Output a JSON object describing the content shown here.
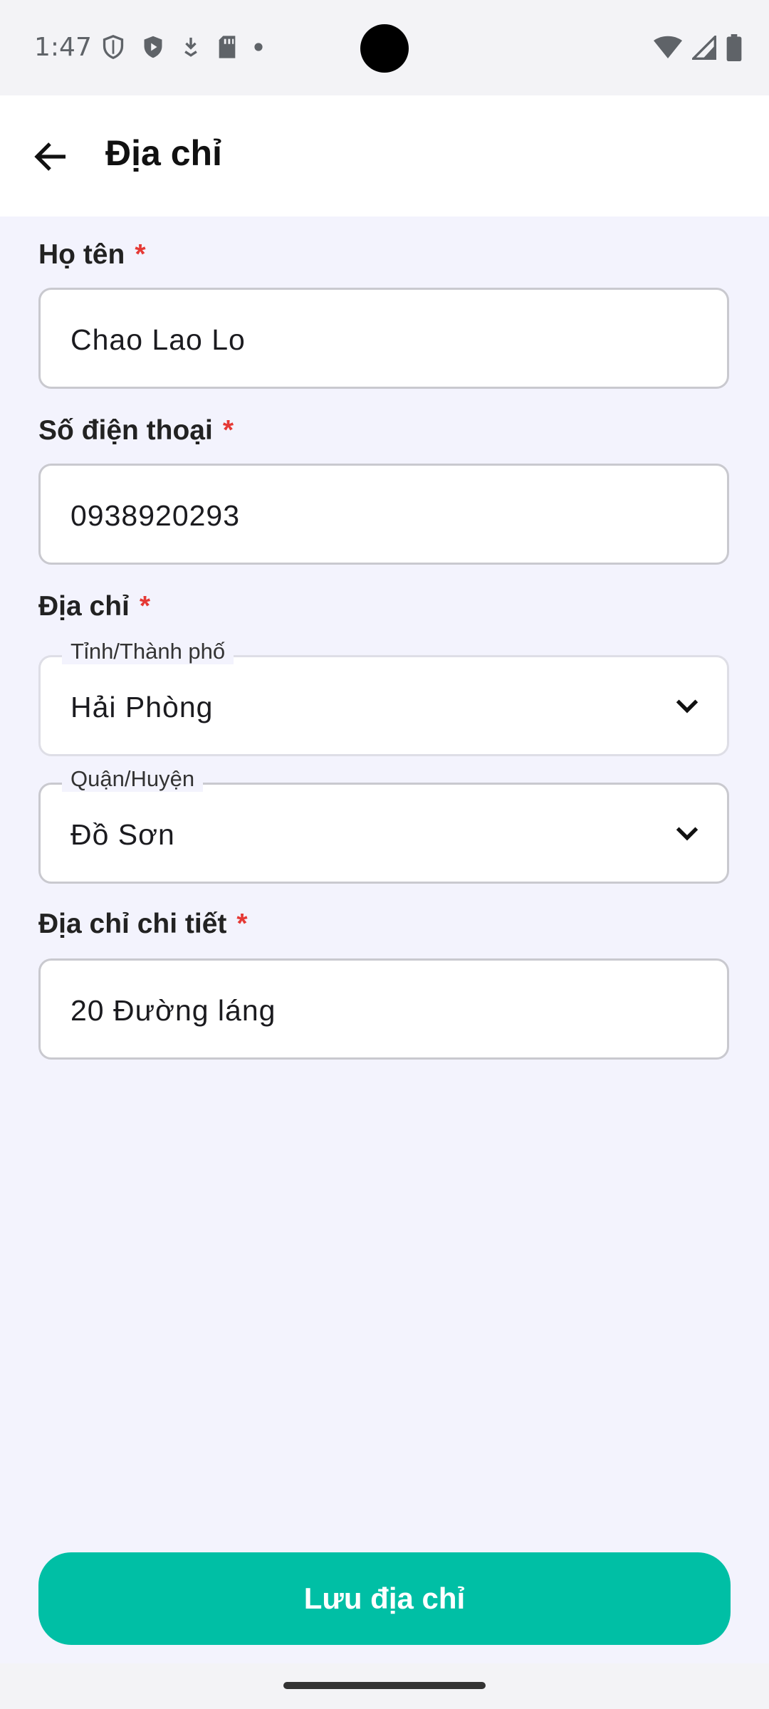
{
  "status_bar": {
    "time": "1:47",
    "icons_left": [
      "shield-outline-icon",
      "shield-play-icon",
      "download-icon",
      "sd-card-icon",
      "dot-icon"
    ],
    "icons_right": [
      "wifi-icon",
      "signal-icon",
      "battery-icon"
    ]
  },
  "header": {
    "title": "Địa chỉ",
    "back_icon": "arrow-left-icon"
  },
  "form": {
    "name": {
      "label": "Họ tên",
      "required_mark": "*",
      "value": "Chao Lao Lo"
    },
    "phone": {
      "label": "Số điện thoại",
      "required_mark": "*",
      "value": "0938920293"
    },
    "address": {
      "label": "Địa chỉ",
      "required_mark": "*",
      "province": {
        "floating_label": "Tỉnh/Thành phố",
        "value": "Hải Phòng"
      },
      "district": {
        "floating_label": "Quận/Huyện",
        "value": "Đồ Sơn"
      }
    },
    "detail": {
      "label": "Địa chỉ chi tiết",
      "required_mark": "*",
      "value": "20 Đường láng"
    }
  },
  "actions": {
    "save_label": "Lưu địa chỉ"
  },
  "colors": {
    "accent": "#00bfa5",
    "required": "#e53935",
    "background": "#f3f3fd"
  }
}
